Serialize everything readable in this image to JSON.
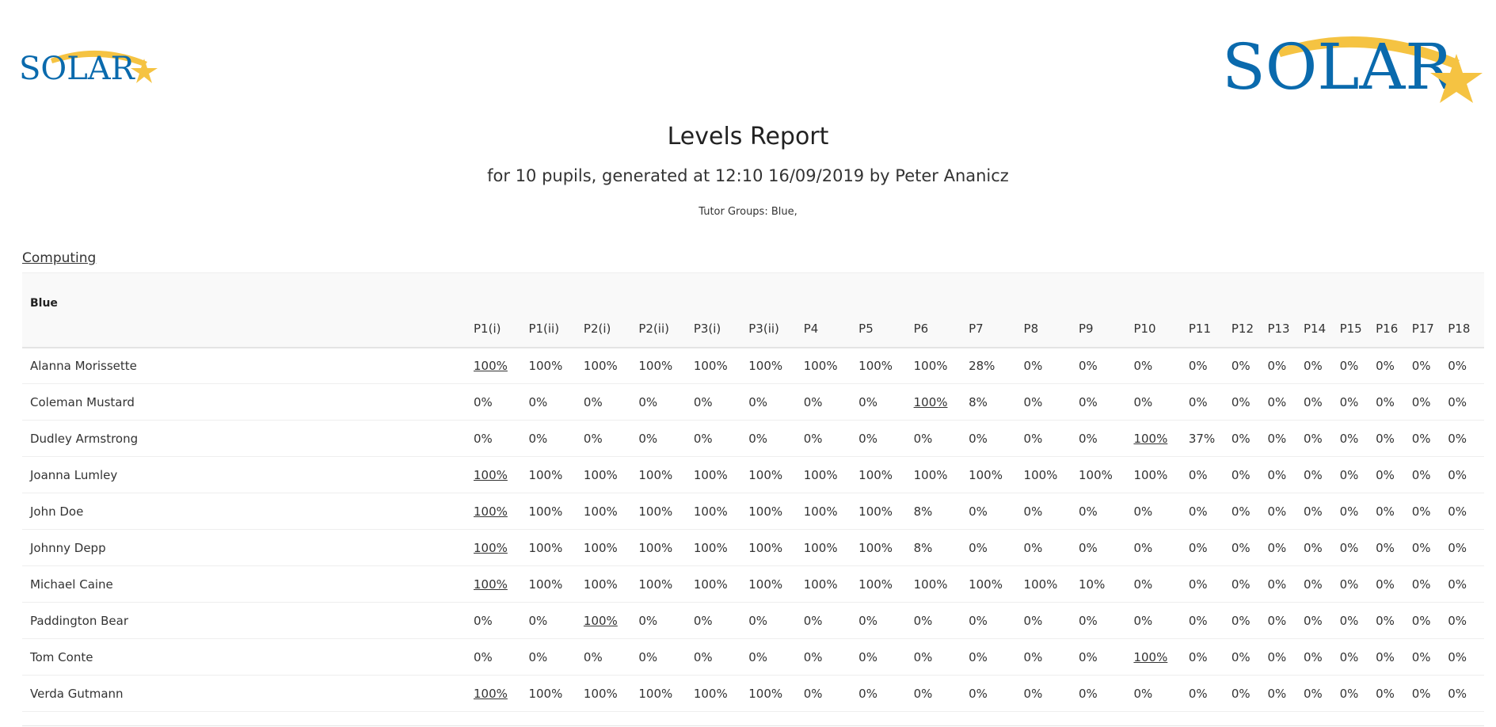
{
  "header": {
    "logo_text": "SOLAR",
    "brand_colors": {
      "blue": "#0a6aad",
      "gold": "#f5c342"
    }
  },
  "report": {
    "title": "Levels Report",
    "subtitle": "for 10 pupils, generated at 12:10 16/09/2019 by Peter Ananicz",
    "tutor_groups": "Tutor Groups: Blue,"
  },
  "subject": {
    "name": "Computing"
  },
  "table": {
    "group_label": "Blue",
    "columns": [
      "P1(i)",
      "P1(ii)",
      "P2(i)",
      "P2(ii)",
      "P3(i)",
      "P3(ii)",
      "P4",
      "P5",
      "P6",
      "P7",
      "P8",
      "P9",
      "P10",
      "P11",
      "P12",
      "P13",
      "P14",
      "P15",
      "P16",
      "P17",
      "P18"
    ],
    "rows": [
      {
        "name": "Alanna Morissette",
        "link_index": 0,
        "values": [
          "100%",
          "100%",
          "100%",
          "100%",
          "100%",
          "100%",
          "100%",
          "100%",
          "100%",
          "28%",
          "0%",
          "0%",
          "0%",
          "0%",
          "0%",
          "0%",
          "0%",
          "0%",
          "0%",
          "0%",
          "0%"
        ]
      },
      {
        "name": "Coleman Mustard",
        "link_index": 8,
        "values": [
          "0%",
          "0%",
          "0%",
          "0%",
          "0%",
          "0%",
          "0%",
          "0%",
          "100%",
          "8%",
          "0%",
          "0%",
          "0%",
          "0%",
          "0%",
          "0%",
          "0%",
          "0%",
          "0%",
          "0%",
          "0%"
        ]
      },
      {
        "name": "Dudley Armstrong",
        "link_index": 12,
        "values": [
          "0%",
          "0%",
          "0%",
          "0%",
          "0%",
          "0%",
          "0%",
          "0%",
          "0%",
          "0%",
          "0%",
          "0%",
          "100%",
          "37%",
          "0%",
          "0%",
          "0%",
          "0%",
          "0%",
          "0%",
          "0%"
        ]
      },
      {
        "name": "Joanna Lumley",
        "link_index": 0,
        "values": [
          "100%",
          "100%",
          "100%",
          "100%",
          "100%",
          "100%",
          "100%",
          "100%",
          "100%",
          "100%",
          "100%",
          "100%",
          "100%",
          "0%",
          "0%",
          "0%",
          "0%",
          "0%",
          "0%",
          "0%",
          "0%"
        ]
      },
      {
        "name": "John Doe",
        "link_index": 0,
        "values": [
          "100%",
          "100%",
          "100%",
          "100%",
          "100%",
          "100%",
          "100%",
          "100%",
          "8%",
          "0%",
          "0%",
          "0%",
          "0%",
          "0%",
          "0%",
          "0%",
          "0%",
          "0%",
          "0%",
          "0%",
          "0%"
        ]
      },
      {
        "name": "Johnny Depp",
        "link_index": 0,
        "values": [
          "100%",
          "100%",
          "100%",
          "100%",
          "100%",
          "100%",
          "100%",
          "100%",
          "8%",
          "0%",
          "0%",
          "0%",
          "0%",
          "0%",
          "0%",
          "0%",
          "0%",
          "0%",
          "0%",
          "0%",
          "0%"
        ]
      },
      {
        "name": "Michael Caine",
        "link_index": 0,
        "values": [
          "100%",
          "100%",
          "100%",
          "100%",
          "100%",
          "100%",
          "100%",
          "100%",
          "100%",
          "100%",
          "100%",
          "10%",
          "0%",
          "0%",
          "0%",
          "0%",
          "0%",
          "0%",
          "0%",
          "0%",
          "0%"
        ]
      },
      {
        "name": "Paddington Bear",
        "link_index": 2,
        "values": [
          "0%",
          "0%",
          "100%",
          "0%",
          "0%",
          "0%",
          "0%",
          "0%",
          "0%",
          "0%",
          "0%",
          "0%",
          "0%",
          "0%",
          "0%",
          "0%",
          "0%",
          "0%",
          "0%",
          "0%",
          "0%"
        ]
      },
      {
        "name": "Tom Conte",
        "link_index": 12,
        "values": [
          "0%",
          "0%",
          "0%",
          "0%",
          "0%",
          "0%",
          "0%",
          "0%",
          "0%",
          "0%",
          "0%",
          "0%",
          "100%",
          "0%",
          "0%",
          "0%",
          "0%",
          "0%",
          "0%",
          "0%",
          "0%"
        ]
      },
      {
        "name": "Verda Gutmann",
        "link_index": 0,
        "values": [
          "100%",
          "100%",
          "100%",
          "100%",
          "100%",
          "100%",
          "0%",
          "0%",
          "0%",
          "0%",
          "0%",
          "0%",
          "0%",
          "0%",
          "0%",
          "0%",
          "0%",
          "0%",
          "0%",
          "0%",
          "0%"
        ]
      }
    ]
  }
}
